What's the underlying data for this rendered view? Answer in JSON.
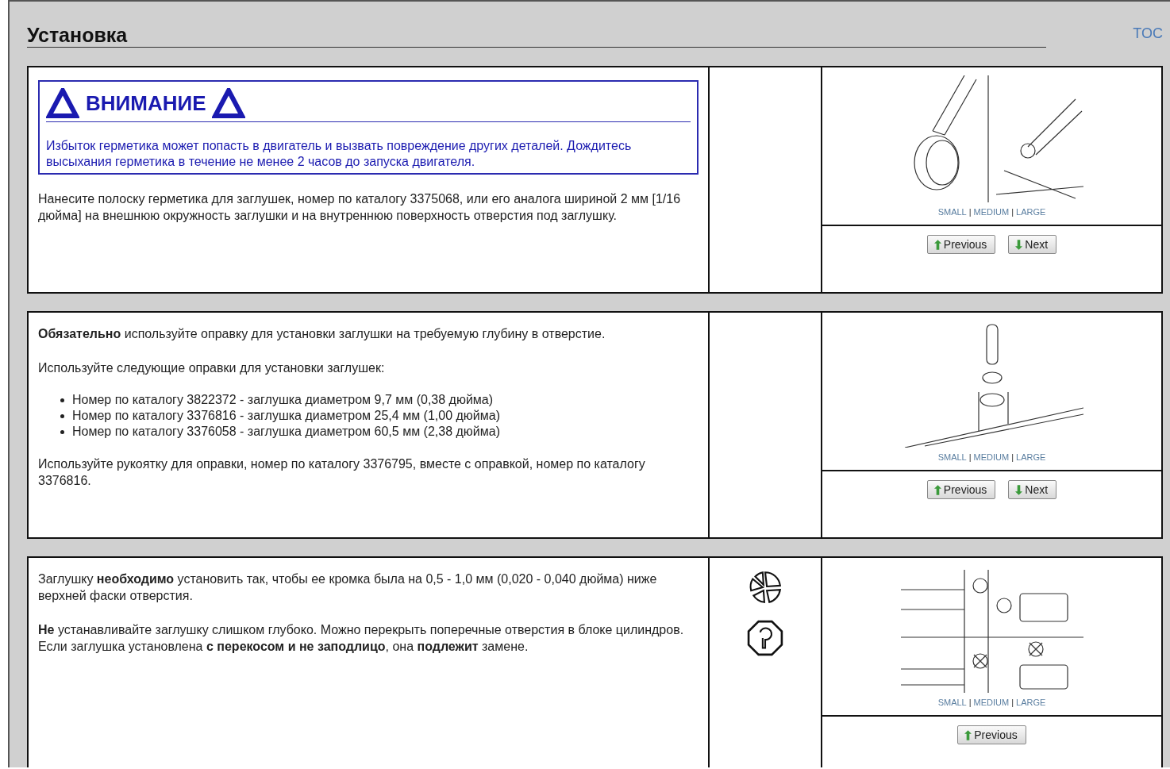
{
  "header": {
    "title": "Установка",
    "toc_link": "TOC"
  },
  "steps": [
    {
      "warning": {
        "title": "ВНИМАНИЕ",
        "text": "Избыток герметика может попасть в двигатель и вызвать повреждение других деталей. Дождитесь высыхания герметика в течение не менее 2 часов до запуска двигателя."
      },
      "blocks": [
        {
          "kind": "para",
          "text": "Нанесите полоску герметика для заглушек, номер по каталогу 3375068, или его аналога шириной 2 мм [1/16 дюйма] на внешнюю окружность заглушки и на внутреннюю поверхность отверстия под заглушку."
        }
      ],
      "figure": {
        "kind": "sealant",
        "size_links": [
          "SMALL",
          "MEDIUM",
          "LARGE"
        ],
        "separator": "|"
      },
      "nav_buttons": [
        {
          "kind": "previous",
          "label": "Previous"
        },
        {
          "kind": "next",
          "label": "Next"
        }
      ]
    },
    {
      "blocks": [
        {
          "kind": "para",
          "text": "**Обязательно** используйте оправку для установки заглушки на требуемую глубину в отверстие."
        },
        {
          "kind": "para",
          "text": "Используйте следующие оправки для установки заглушек:"
        },
        {
          "kind": "list",
          "items": [
            "Номер по каталогу 3822372 - заглушка диаметром 9,7 мм (0,38 дюйма)",
            "Номер по каталогу 3376816 - заглушка диаметром 25,4 мм (1,00 дюйма)",
            "Номер по каталогу 3376058 - заглушка диаметром 60,5 мм (2,38 дюйма)"
          ]
        },
        {
          "kind": "para",
          "text": "Используйте рукоятку для оправки, номер по каталогу 3376795, вместе с оправкой, номер по каталогу 3376816."
        }
      ],
      "figure": {
        "kind": "driver",
        "size_links": [
          "SMALL",
          "MEDIUM",
          "LARGE"
        ],
        "separator": "|"
      },
      "nav_buttons": [
        {
          "kind": "previous",
          "label": "Previous"
        },
        {
          "kind": "next",
          "label": "Next"
        }
      ]
    },
    {
      "blocks": [
        {
          "kind": "para",
          "text": "Заглушку **необходимо** установить так, чтобы ее кромка была на 0,5 - 1,0 мм (0,020 - 0,040 дюйма) ниже верхней фаски отверстия."
        },
        {
          "kind": "para",
          "text": "**Не** устанавливайте заглушку слишком глубоко. Можно перекрыть поперечные отверстия в блоке цилиндров. Если заглушка установлена **с перекосом и не заподлицо**, она **подлежит** замене."
        }
      ],
      "icons": [
        {
          "kind": "parts"
        },
        {
          "kind": "inspect"
        }
      ],
      "figure": {
        "kind": "depth",
        "size_links": [
          "SMALL",
          "MEDIUM",
          "LARGE"
        ],
        "separator": "|"
      },
      "nav_buttons": [
        {
          "kind": "previous",
          "label": "Previous"
        }
      ]
    }
  ]
}
